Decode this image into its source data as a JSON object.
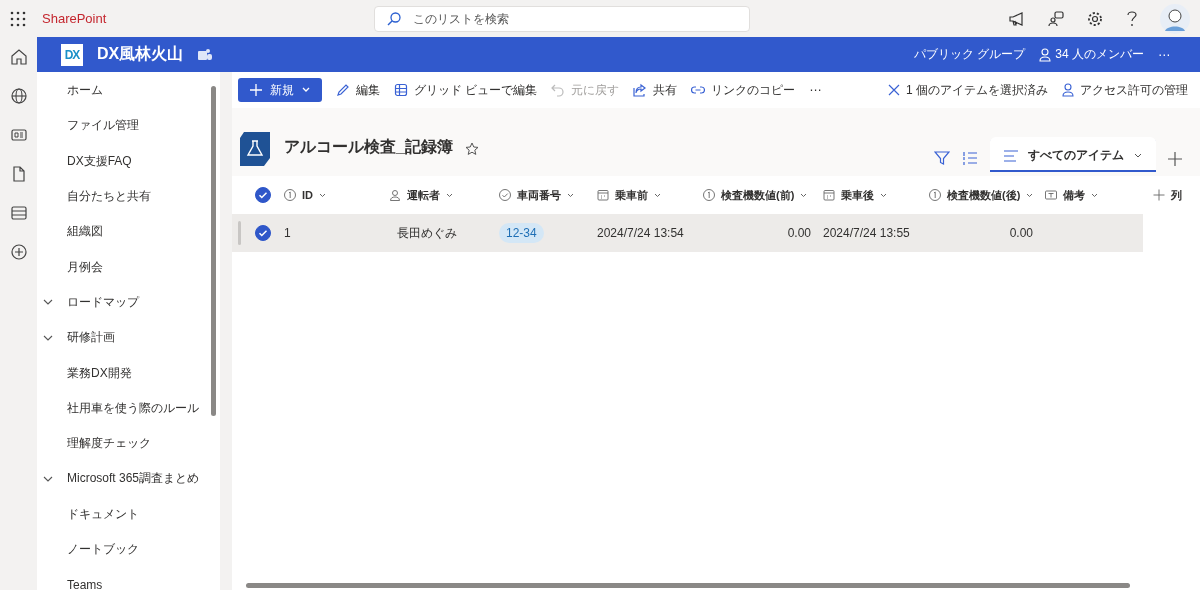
{
  "app": {
    "name": "SharePoint"
  },
  "search": {
    "placeholder": "このリストを検索"
  },
  "site": {
    "logo": "DX",
    "title": "DX風林火山",
    "group": "パブリック グループ",
    "members": "34 人のメンバー",
    "more": "⋯"
  },
  "sidebar": {
    "items": [
      {
        "label": "ホーム",
        "kind": "link"
      },
      {
        "label": "ファイル管理",
        "kind": "link"
      },
      {
        "label": "DX支援FAQ",
        "kind": "link"
      },
      {
        "label": "自分たちと共有",
        "kind": "link"
      },
      {
        "label": "組織図",
        "kind": "link"
      },
      {
        "label": "月例会",
        "kind": "link"
      },
      {
        "label": "ロードマップ",
        "kind": "group",
        "expanded": true
      },
      {
        "label": "研修計画",
        "kind": "group",
        "expanded": true
      },
      {
        "label": "業務DX開発",
        "kind": "link"
      },
      {
        "label": "社用車を使う際のルール",
        "kind": "link"
      },
      {
        "label": "理解度チェック",
        "kind": "link"
      },
      {
        "label": "Microsoft 365調査まとめ",
        "kind": "group",
        "expanded": true
      },
      {
        "label": "ドキュメント",
        "kind": "link"
      },
      {
        "label": "ノートブック",
        "kind": "link"
      },
      {
        "label": "Teams",
        "kind": "link"
      }
    ]
  },
  "toolbar": {
    "new": "新規",
    "actions": [
      {
        "label": "編集",
        "kind": "edit",
        "disabled": false
      },
      {
        "label": "グリッド ビューで編集",
        "kind": "grid",
        "disabled": false
      },
      {
        "label": "元に戻す",
        "kind": "undo",
        "disabled": true
      },
      {
        "label": "共有",
        "kind": "share",
        "disabled": false
      },
      {
        "label": "リンクのコピー",
        "kind": "link",
        "disabled": false
      }
    ],
    "more": "⋯",
    "selection": "1 個のアイテムを選択済み",
    "access": "アクセス許可の管理"
  },
  "list": {
    "title": "アルコール検査_記録簿",
    "view": {
      "label": "すべてのアイテム",
      "selected": true
    }
  },
  "table": {
    "all_selected": true,
    "columns": [
      {
        "label": "ID",
        "kind": "number"
      },
      {
        "label": "運転者",
        "kind": "person"
      },
      {
        "label": "車両番号",
        "kind": "choice"
      },
      {
        "label": "乗車前",
        "kind": "date"
      },
      {
        "label": "検査機数値(前)",
        "kind": "number"
      },
      {
        "label": "乗車後",
        "kind": "date"
      },
      {
        "label": "検査機数値(後)",
        "kind": "number"
      },
      {
        "label": "備考",
        "kind": "text"
      },
      {
        "label": "列",
        "kind": "add"
      }
    ],
    "rows": [
      {
        "selected": true,
        "cells": [
          "1",
          "長田めぐみ",
          "12-34",
          "2024/7/24 13:54",
          "0.00",
          "2024/7/24 13:55",
          "0.00",
          ""
        ]
      }
    ]
  }
}
